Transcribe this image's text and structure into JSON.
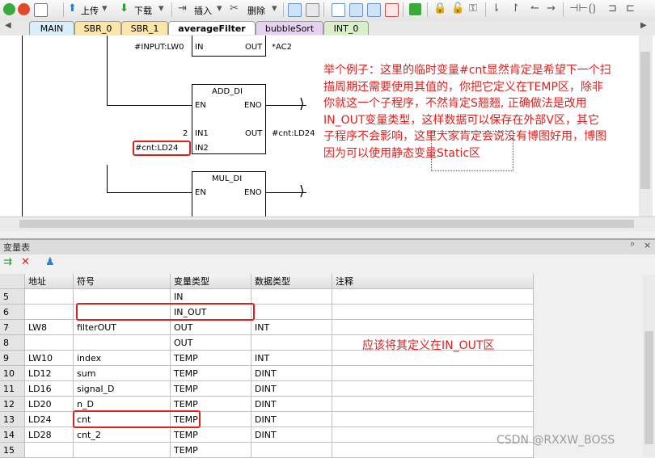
{
  "toolbar": {
    "upload_label": "上传",
    "download_label": "下载",
    "insert_label": "插入",
    "delete_label": "删除"
  },
  "tabs": [
    {
      "label": "MAIN",
      "color": "#d8eef8"
    },
    {
      "label": "SBR_0",
      "color": "#fbe6a8"
    },
    {
      "label": "SBR_1",
      "color": "#fbe6a8"
    },
    {
      "label": "averageFilter",
      "color": "#fbe6a8"
    },
    {
      "label": "bubbleSort",
      "color": "#e6d2f0"
    },
    {
      "label": "INT_0",
      "color": "#d9efc8"
    }
  ],
  "ladder": {
    "top_in_label": "#INPUT:LW0",
    "top_in_pin": "IN",
    "top_out_pin": "OUT",
    "top_out_label": "*AC2",
    "add_title": "ADD_DI",
    "add_en": "EN",
    "add_eno": "ENO",
    "add_in1_const": "2",
    "add_in1": "IN1",
    "add_out": "OUT",
    "add_out_label": "#cnt:LD24",
    "add_in2_label": "#cnt:LD24",
    "add_in2": "IN2",
    "mul_title": "MUL_DI",
    "mul_en": "EN",
    "mul_eno": "ENO"
  },
  "annotation_top": [
    "举个例子：这里的临时变量#cnt显然肯定是希望下一个扫",
    "描周期还需要使用其值的，你把它定义在TEMP区，除非",
    "你就这一个子程序，不然肯定S翘翘, 正确做法是改用",
    "IN_OUT变量类型，这样数据可以保存在外部V区，其它",
    "子程序不会影响，这里大家肯定会说没有博图好用，博图",
    "因为可以使用静态变量Static区"
  ],
  "var_table": {
    "title": "变量表",
    "pin_glyph": "ᵖ",
    "close_glyph": "×",
    "headers": [
      "",
      "地址",
      "符号",
      "变量类型",
      "数据类型",
      "注释"
    ],
    "rows": [
      [
        "5",
        "",
        "",
        "IN",
        "",
        ""
      ],
      [
        "6",
        "",
        "",
        "IN_OUT",
        "",
        ""
      ],
      [
        "7",
        "LW8",
        "filterOUT",
        "OUT",
        "INT",
        ""
      ],
      [
        "8",
        "",
        "",
        "OUT",
        "",
        ""
      ],
      [
        "9",
        "LW10",
        "index",
        "TEMP",
        "INT",
        ""
      ],
      [
        "10",
        "LD12",
        "sum",
        "TEMP",
        "DINT",
        ""
      ],
      [
        "11",
        "LD16",
        "signal_D",
        "TEMP",
        "DINT",
        ""
      ],
      [
        "12",
        "LD20",
        "n_D",
        "TEMP",
        "DINT",
        ""
      ],
      [
        "13",
        "LD24",
        "cnt",
        "TEMP",
        "DINT",
        ""
      ],
      [
        "14",
        "LD28",
        "cnt_2",
        "TEMP",
        "DINT",
        ""
      ],
      [
        "15",
        "",
        "",
        "TEMP",
        "",
        ""
      ]
    ]
  },
  "annotation_bottom": "应该将其定义在IN_OUT区",
  "watermark": "CSDN @RXXW_BOSS",
  "colors": {
    "annotation": "#e0201e",
    "highlight": "#e0201e"
  }
}
